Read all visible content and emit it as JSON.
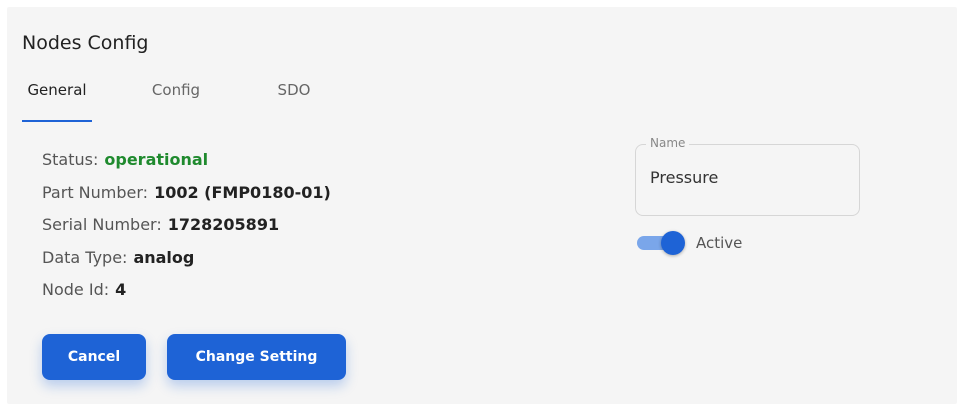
{
  "page": {
    "title": "Nodes Config"
  },
  "tabs": [
    {
      "label": "General",
      "active": true
    },
    {
      "label": "Config",
      "active": false
    },
    {
      "label": "SDO",
      "active": false
    }
  ],
  "info": {
    "status_label": "Status:",
    "status_value": "operational",
    "part_number_label": "Part Number:",
    "part_number_value": "1002 (FMP0180-01)",
    "serial_number_label": "Serial Number:",
    "serial_number_value": "1728205891",
    "data_type_label": "Data Type:",
    "data_type_value": "analog",
    "node_id_label": "Node Id:",
    "node_id_value": "4"
  },
  "buttons": {
    "cancel": "Cancel",
    "change_setting": "Change Setting"
  },
  "name_field": {
    "label": "Name",
    "value": "Pressure"
  },
  "active_toggle": {
    "label": "Active",
    "checked": true
  },
  "colors": {
    "accent": "#1e63d6",
    "status_ok": "#1f8a2e",
    "panel_bg": "#f5f5f5"
  }
}
